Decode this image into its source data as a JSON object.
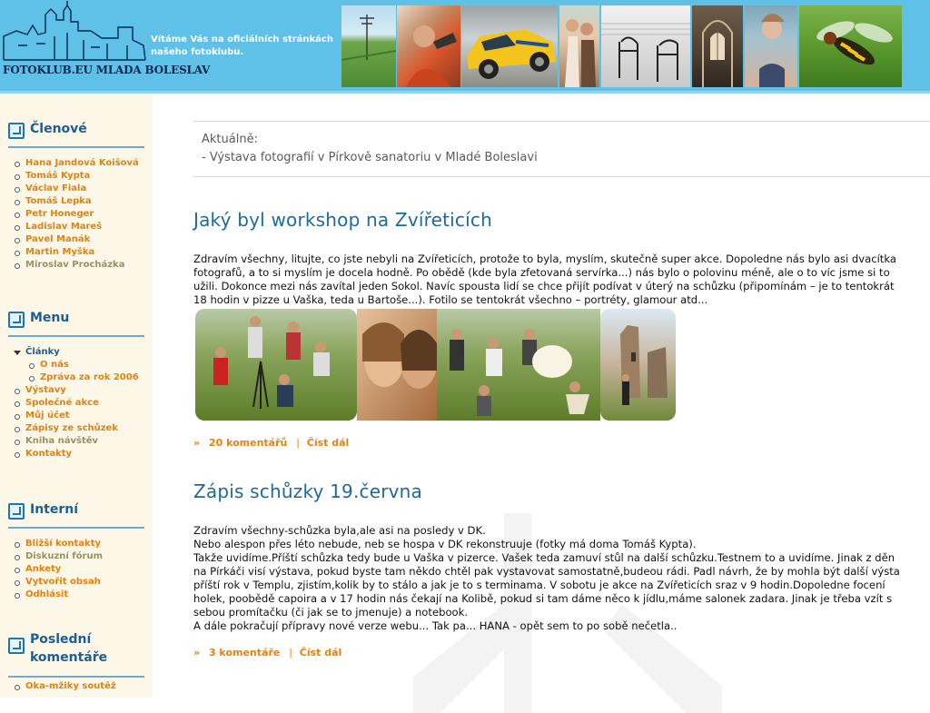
{
  "header": {
    "logo_text": "FOTOKLUB.EU MLADA BOLESLAV",
    "welcome": "Vítáme Vás na oficiálních stránkách našeho fotoklubu."
  },
  "sidebar": {
    "members": {
      "title": "Členové",
      "items": [
        "Hana Jandová Koišová",
        "Tomáš Kypta",
        "Václav Fiala",
        "Tomáš Lepka",
        "Petr Honeger",
        "Ladislav Mareš",
        "Pavel Manák",
        "Martin Myška",
        "Miroslav Procházka"
      ]
    },
    "menu": {
      "title": "Menu",
      "items": [
        "Články",
        "O nás",
        "Zpráva za rok 2006",
        "Výstavy",
        "Společné akce",
        "Můj účet",
        "Zápisy ze schůzek",
        "Kniha návštěv",
        "Kontakty"
      ]
    },
    "internal": {
      "title": "Interní",
      "items": [
        "Bližší kontakty",
        "Diskuzní fórum",
        "Ankety",
        "Vytvořit obsah",
        "Odhlásit"
      ]
    },
    "comments": {
      "title": "Poslední komentáře",
      "items": [
        "Oka-mžiky soutěž"
      ]
    }
  },
  "news": {
    "label": "Aktuálně:",
    "item": "- Výstava fotografií v Pírkově sanatoriu v Mladé Boleslavi"
  },
  "articles": [
    {
      "title": "Jaký byl workshop na Zvířeticích",
      "lines": [
        "Zdravím všechny, litujte, co jste nebyli na Zvířeticích, protože to byla, myslím, skutečně super akce. Dopoledne nás bylo asi dvacítka",
        "fotografů, a to si myslím je docela hodně. Po obědě (kde byla zfetovaná servírka...) nás bylo o polovinu méně, ale o to víc jsme si to",
        "užili. Dokonce mezi nás zavítal jeden Sokol. Navíc spousta lidí se chce přijít podívat v úterý na schůzku (připomínám – je to tentokrát",
        "18 hodin v pizze u Vaška, teda u Bartoše...). Fotilo se tentokrát všechno – portréty, glamour atd..."
      ],
      "comments": "20 komentářů",
      "read_more": "Číst dál"
    },
    {
      "title": "Zápis schůzky 19.června",
      "lines": [
        "Zdravím všechny-schůzka byla,ale asi na posledy v DK.",
        "Nebo alespon přes léto nebude, neb se hospa v DK rekonstruuje (fotky má doma Tomáš Kypta).",
        "Takže uvidíme.Příští schůzka tedy bude u Vaška v pizerce. Vašek teda zamuví stůl na další schůzku.Testnem to a uvidíme. Jinak z děn",
        "na Pírkáči visí výstava, pokud byste tam někdo chtěl pak vystavovat samostatně,budeou rádi. Padl návrh, že by mohla být další výsta",
        "příští rok v Templu, zjistím,kolik by to stálo a jak je to s terminama. V sobotu je akce na Zvířeticích sraz v 9 hodin.Dopoledne focení",
        "holek, poobědě capoira a v 17 hodin nás čekají na Kolibě, pokud si tam dáme něco k jídlu,máme salonek zadara. Jinak je třeba vzít s",
        "sebou promítačku (či jak se to jmenuje) a notebook.",
        "A dále pokračují přípravy nové verze webu... Tak pa... HANA - opět sem to po sobě nečetla.."
      ],
      "comments": "3 komentáře",
      "read_more": "Číst dál"
    }
  ],
  "colors": {
    "header_bg": "#5fc0e8",
    "sidebar_bg": "#fdf7e8",
    "link_orange": "#e3820e",
    "title_blue": "#1d6a9a"
  }
}
